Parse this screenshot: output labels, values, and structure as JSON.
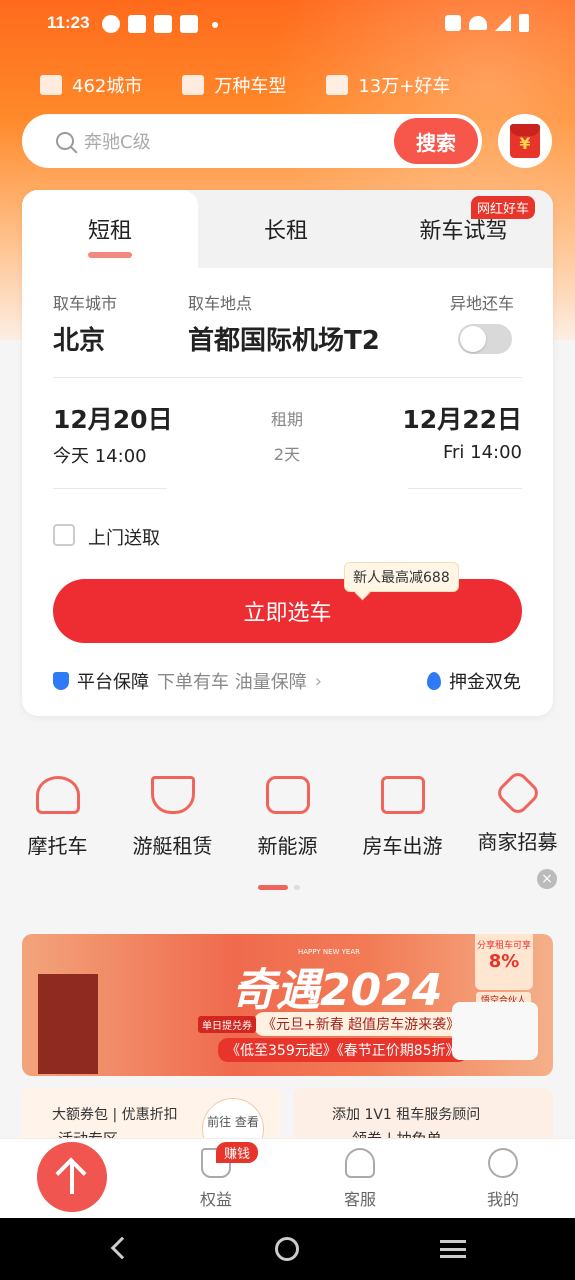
{
  "status": {
    "time": "11:23"
  },
  "features": [
    {
      "icon": "city-icon",
      "label": "462城市"
    },
    {
      "icon": "car-icon",
      "label": "万种车型"
    },
    {
      "icon": "thumbs-up-icon",
      "label": "13万+好车"
    }
  ],
  "search": {
    "placeholder": "奔驰C级",
    "button": "搜索"
  },
  "tabs": [
    {
      "label": "短租",
      "active": true
    },
    {
      "label": "长租",
      "active": false
    },
    {
      "label": "新车试驾",
      "active": false,
      "badge": "网红好车"
    }
  ],
  "form": {
    "pickup_city_label": "取车城市",
    "pickup_city": "北京",
    "pickup_place_label": "取车地点",
    "pickup_place": "首都国际机场T2",
    "return_other_label": "异地还车",
    "start_date": "12月20日",
    "start_time": "今天 14:00",
    "duration_label": "租期",
    "duration": "2天",
    "end_date": "12月22日",
    "end_time": "Fri 14:00",
    "door_delivery": "上门送取",
    "tooltip": "新人最高减688",
    "submit": "立即选车",
    "guarantee_main": "平台保障",
    "guarantee_rest": "下单有车 油量保障",
    "deposit": "押金双免"
  },
  "services": [
    {
      "icon": "motorcycle-icon",
      "label": "摩托车"
    },
    {
      "icon": "yacht-icon",
      "label": "游艇租赁"
    },
    {
      "icon": "ev-car-icon",
      "label": "新能源"
    },
    {
      "icon": "rv-icon",
      "label": "房车出游"
    },
    {
      "icon": "handshake-icon",
      "label": "商家招募"
    }
  ],
  "banner": {
    "title": "奇遇2024",
    "happy": "HAPPY NEW YEAR",
    "line1": "《元旦+新春 超值房车游来袭》",
    "line2": "《低至359元起》《春节正价期85折》",
    "tag": "单日提兑券",
    "share_top": "分享租车可享",
    "share_pct": "8%",
    "share_sub": "悟空合伙人"
  },
  "minis": {
    "left_title": "大额券包 | 优惠折扣",
    "left_sub": "活动专区",
    "left_circle": "前往 查看",
    "right_title": "添加 1V1 租车服务顾问",
    "right_sub": "领券 | 抽免单"
  },
  "bottom_nav": [
    {
      "icon": "gift-bag-icon",
      "label": "权益",
      "badge": "赚钱"
    },
    {
      "icon": "headset-icon",
      "label": "客服"
    },
    {
      "icon": "user-icon",
      "label": "我的"
    }
  ]
}
